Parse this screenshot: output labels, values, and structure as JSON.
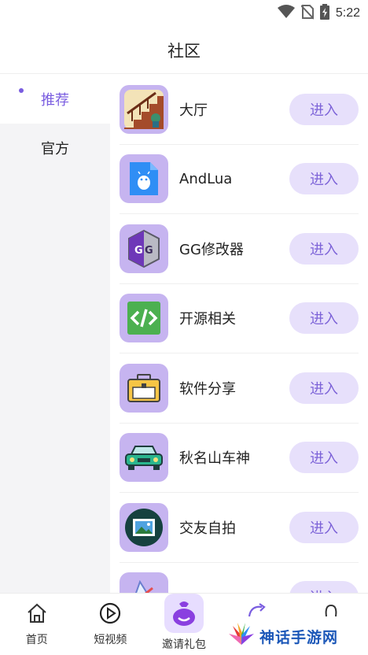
{
  "status_bar": {
    "time": "5:22",
    "icons": [
      "wifi-icon",
      "no-sim-icon",
      "battery-charging-icon"
    ]
  },
  "header": {
    "title": "社区"
  },
  "sidebar": {
    "items": [
      {
        "label": "推荐",
        "active": true
      },
      {
        "label": "官方",
        "active": false
      }
    ]
  },
  "list": {
    "enter_label": "进入",
    "items": [
      {
        "label": "大厅",
        "icon": "staircase-icon"
      },
      {
        "label": "AndLua",
        "icon": "android-file-icon"
      },
      {
        "label": "GG修改器",
        "icon": "gg-logo-icon"
      },
      {
        "label": "开源相关",
        "icon": "code-icon"
      },
      {
        "label": "软件分享",
        "icon": "toolbox-icon"
      },
      {
        "label": "秋名山车神",
        "icon": "car-icon"
      },
      {
        "label": "交友自拍",
        "icon": "photo-icon"
      },
      {
        "label": "",
        "icon": "partial-icon"
      }
    ]
  },
  "bottom_nav": {
    "items": [
      {
        "label": "首页",
        "icon": "home-icon"
      },
      {
        "label": "短视频",
        "icon": "play-icon"
      },
      {
        "label": "邀请礼包",
        "icon": "gift-bag-icon"
      },
      {
        "label": "",
        "icon": "community-icon"
      },
      {
        "label": "",
        "icon": "mine-icon"
      }
    ]
  },
  "watermark": {
    "text": "神话手游网",
    "icon": "watermark-logo-icon"
  },
  "colors": {
    "accent": "#7a5de0",
    "button_bg": "#e7e0fb",
    "icon_bg": "#c6b4f0",
    "sidebar_bg": "#f4f4f6"
  }
}
